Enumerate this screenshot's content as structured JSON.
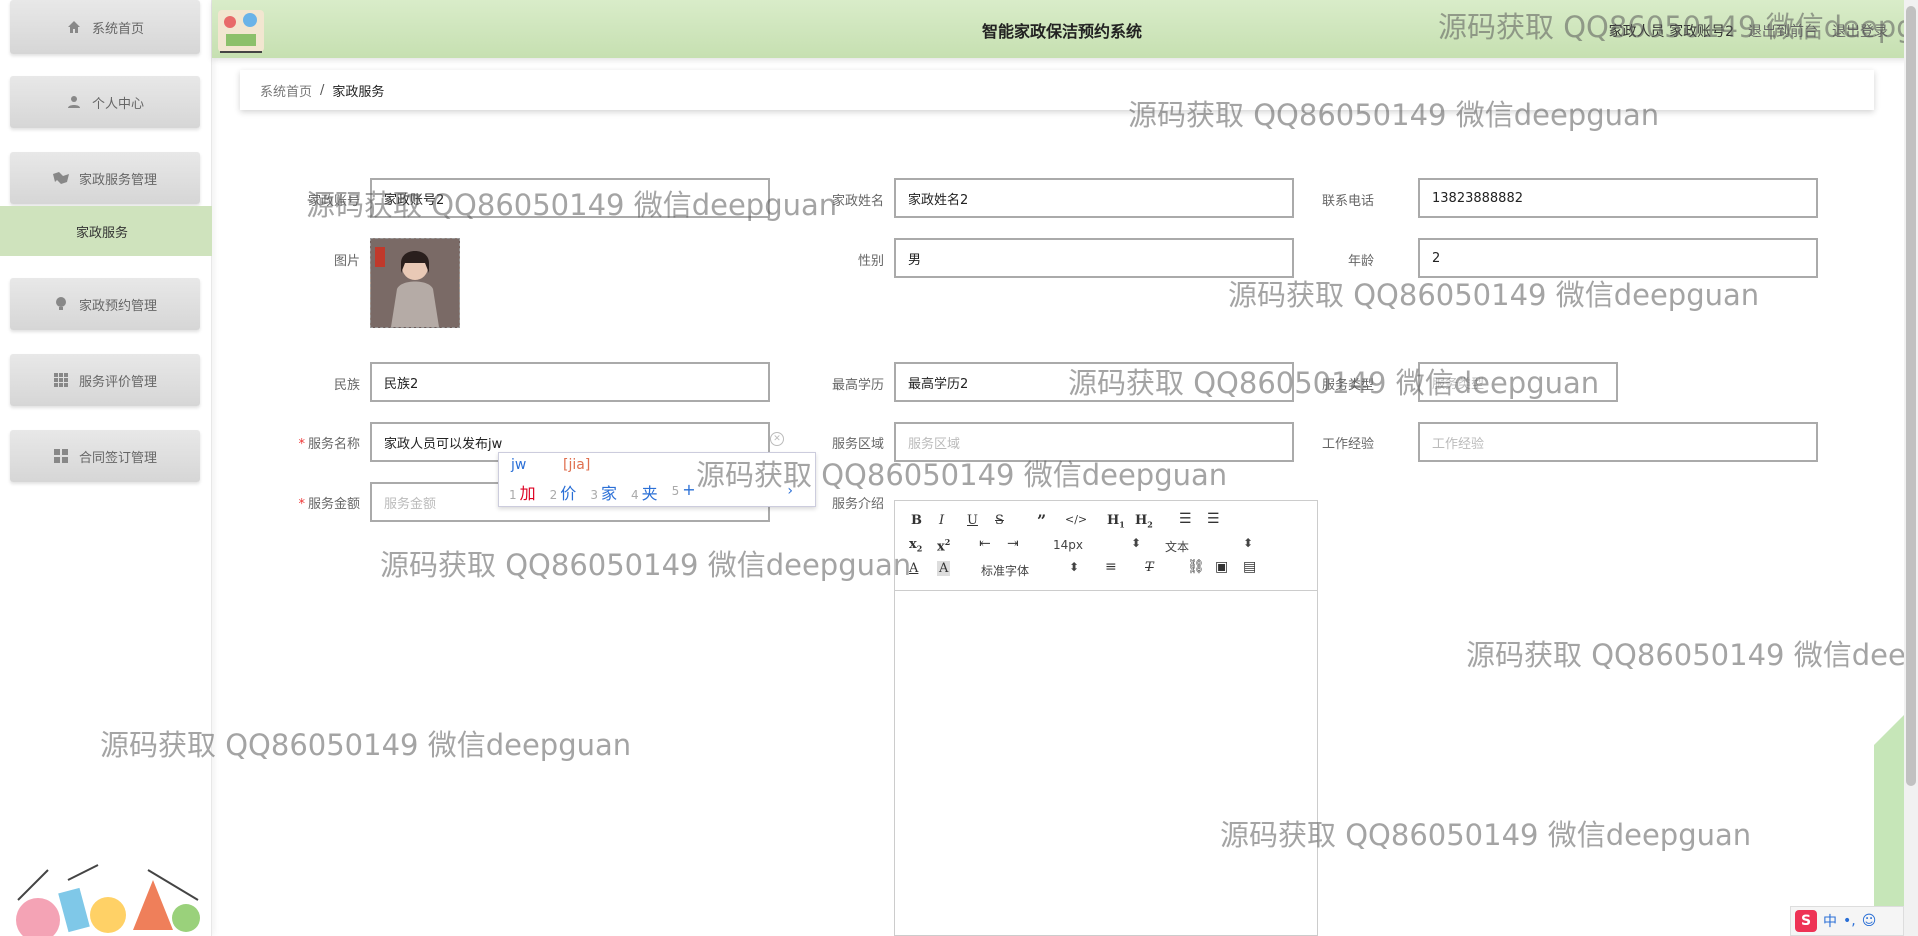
{
  "app": {
    "title": "智能家政保洁预约系统"
  },
  "header": {
    "user_text": "家政人员 家政账号2",
    "back_label": "退出到前台",
    "logout_label": "退出登录"
  },
  "sidebar": {
    "items": [
      {
        "label": "系统首页",
        "icon": "home-icon"
      },
      {
        "label": "个人中心",
        "icon": "user-icon"
      },
      {
        "label": "家政服务管理",
        "icon": "service-icon"
      },
      {
        "label": "家政预约管理",
        "icon": "bulb-icon"
      },
      {
        "label": "服务评价管理",
        "icon": "grid-icon"
      },
      {
        "label": "合同签订管理",
        "icon": "grid4-icon"
      }
    ],
    "active_sub": "家政服务"
  },
  "breadcrumb": {
    "home": "系统首页",
    "separator": "/",
    "current": "家政服务"
  },
  "form": {
    "account_label": "家政账号",
    "account_value": "家政账号2",
    "name_label": "家政姓名",
    "name_value": "家政姓名2",
    "phone_label": "联系电话",
    "phone_value": "13823888882",
    "photo_label": "图片",
    "gender_label": "性别",
    "gender_value": "男",
    "age_label": "年龄",
    "age_value": "2",
    "ethnicity_label": "民族",
    "ethnicity_value": "民族2",
    "education_label": "最高学历",
    "education_value": "最高学历2",
    "service_type_label": "服务类型",
    "service_type_placeholder": "服务类型",
    "service_name_label": "服务名称",
    "service_name_value": "家政人员可以发布jw",
    "area_label": "服务区域",
    "area_placeholder": "服务区域",
    "experience_label": "工作经验",
    "experience_placeholder": "工作经验",
    "amount_label": "服务金额",
    "amount_placeholder": "服务金额",
    "intro_label": "服务介绍",
    "required_mark": "*"
  },
  "ime": {
    "composition": "jw",
    "pinyin": "[jia]",
    "candidates": [
      {
        "n": "1",
        "text": "加"
      },
      {
        "n": "2",
        "text": "价"
      },
      {
        "n": "3",
        "text": "家"
      },
      {
        "n": "4",
        "text": "夹"
      },
      {
        "n": "5",
        "text": "+"
      }
    ],
    "more": "›"
  },
  "editor": {
    "font_size": "14px",
    "paragraph": "文本",
    "font_family": "标准字体"
  },
  "tray": {
    "logo": "S",
    "mode": "中",
    "punct": "•,",
    "emoji": "☺"
  },
  "watermark": "源码获取 QQ86050149 微信deepguan",
  "colors": {
    "header_green": "#c6e0b1",
    "active_green": "#cfe3bd",
    "required_red": "#ee3333"
  }
}
